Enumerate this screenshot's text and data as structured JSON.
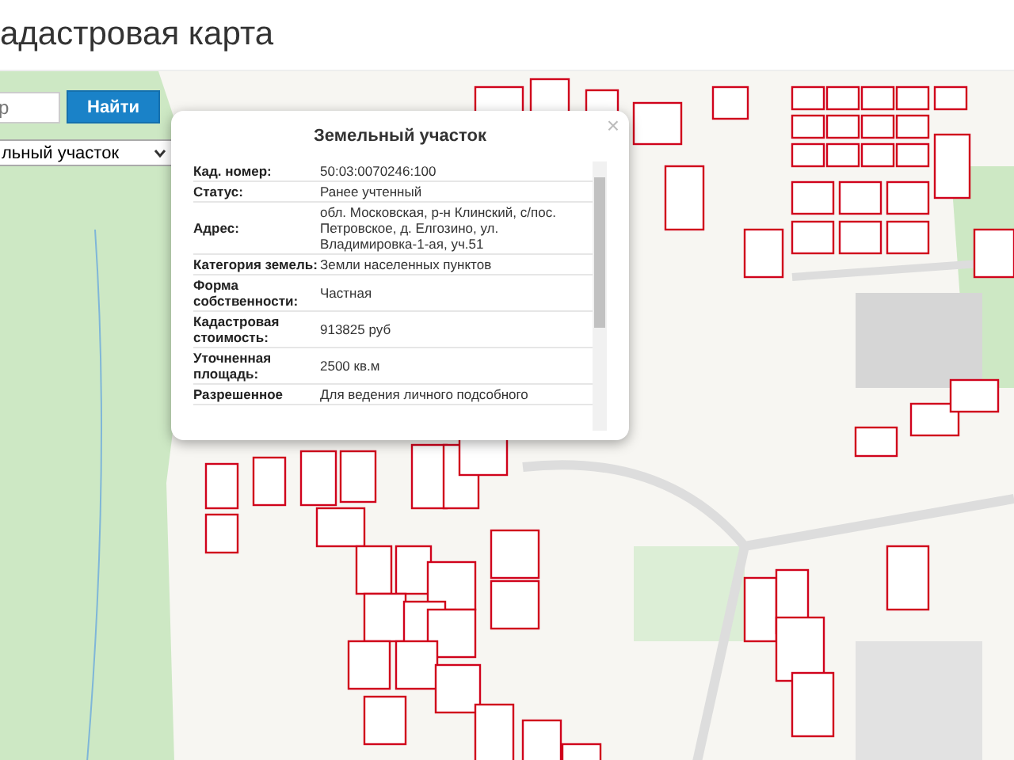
{
  "header": {
    "title": "адастровая карта"
  },
  "search": {
    "placeholder": "р",
    "button": "Найти"
  },
  "type_select": {
    "value": "льный участок"
  },
  "popup": {
    "title": "Земельный участок",
    "close": "×",
    "rows": [
      {
        "label": "Кад. номер:",
        "value": "50:03:0070246:100"
      },
      {
        "label": "Статус:",
        "value": "Ранее учтенный"
      },
      {
        "label": "Адрес:",
        "value": "обл. Московская, р-н Клинский, с/пос. Петровское, д. Елгозино, ул. Владимировка-1-ая, уч.51"
      },
      {
        "label": "Категория земель:",
        "value": "Земли населенных пунктов"
      },
      {
        "label": "Форма собственности:",
        "value": "Частная"
      },
      {
        "label": "Кадастровая стоимость:",
        "value": "913825 руб"
      },
      {
        "label": "Уточненная площадь:",
        "value": "2500 кв.м"
      },
      {
        "label": "Разрешенное",
        "value": "Для ведения личного подсобного"
      }
    ]
  }
}
